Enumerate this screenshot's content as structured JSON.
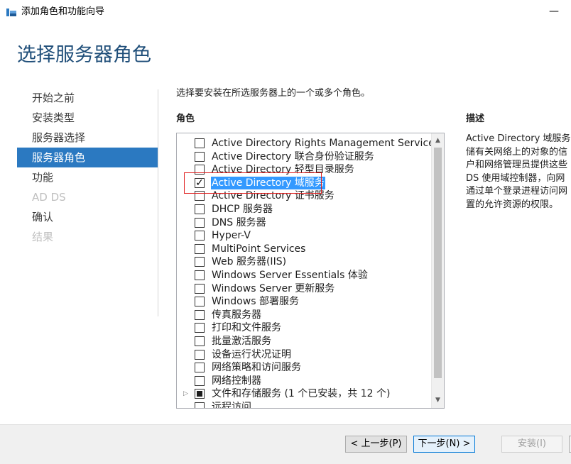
{
  "window": {
    "title": "添加角色和功能向导",
    "minimize_glyph": "—"
  },
  "page": {
    "title": "选择服务器角色"
  },
  "nav": {
    "items": [
      {
        "label": "开始之前",
        "state": "normal"
      },
      {
        "label": "安装类型",
        "state": "normal"
      },
      {
        "label": "服务器选择",
        "state": "normal"
      },
      {
        "label": "服务器角色",
        "state": "active"
      },
      {
        "label": "功能",
        "state": "normal"
      },
      {
        "label": "AD DS",
        "state": "disabled"
      },
      {
        "label": "确认",
        "state": "normal"
      },
      {
        "label": "结果",
        "state": "disabled"
      }
    ]
  },
  "main": {
    "instruction": "选择要安装在所选服务器上的一个或多个角色。",
    "roles_heading": "角色",
    "roles": [
      {
        "label": "Active Directory Rights Management Services",
        "checked": false
      },
      {
        "label": "Active Directory 联合身份验证服务",
        "checked": false
      },
      {
        "label": "Active Directory 轻型目录服务",
        "checked": false
      },
      {
        "label": "Active Directory 域服务",
        "checked": true,
        "selected": true
      },
      {
        "label": "Active Directory 证书服务",
        "checked": false
      },
      {
        "label": "DHCP 服务器",
        "checked": false
      },
      {
        "label": "DNS 服务器",
        "checked": false
      },
      {
        "label": "Hyper-V",
        "checked": false
      },
      {
        "label": "MultiPoint Services",
        "checked": false
      },
      {
        "label": "Web 服务器(IIS)",
        "checked": false
      },
      {
        "label": "Windows Server Essentials 体验",
        "checked": false
      },
      {
        "label": "Windows Server 更新服务",
        "checked": false
      },
      {
        "label": "Windows 部署服务",
        "checked": false
      },
      {
        "label": "传真服务器",
        "checked": false
      },
      {
        "label": "打印和文件服务",
        "checked": false
      },
      {
        "label": "批量激活服务",
        "checked": false
      },
      {
        "label": "设备运行状况证明",
        "checked": false
      },
      {
        "label": "网络策略和访问服务",
        "checked": false
      },
      {
        "label": "网络控制器",
        "checked": false
      },
      {
        "label": "文件和存储服务 (1 个已安装，共 12 个)",
        "checked": "partial",
        "expandable": true
      },
      {
        "label": "远程访问",
        "checked": false
      }
    ],
    "description_heading": "描述",
    "description_lines": [
      "Active Directory 域服务",
      "储有关网络上的对象的信",
      "户和网络管理员提供这些",
      "DS 使用域控制器，向网",
      "通过单个登录进程访问网",
      "置的允许资源的权限。"
    ]
  },
  "footer": {
    "prev_label": "< 上一步(P)",
    "next_label": "下一步(N) >",
    "install_label": "安装(I)"
  },
  "colors": {
    "title_blue": "#1f4e79",
    "nav_active_bg": "#2b79c1",
    "selection_bg": "#3399ff",
    "highlight_red": "#e02020"
  }
}
